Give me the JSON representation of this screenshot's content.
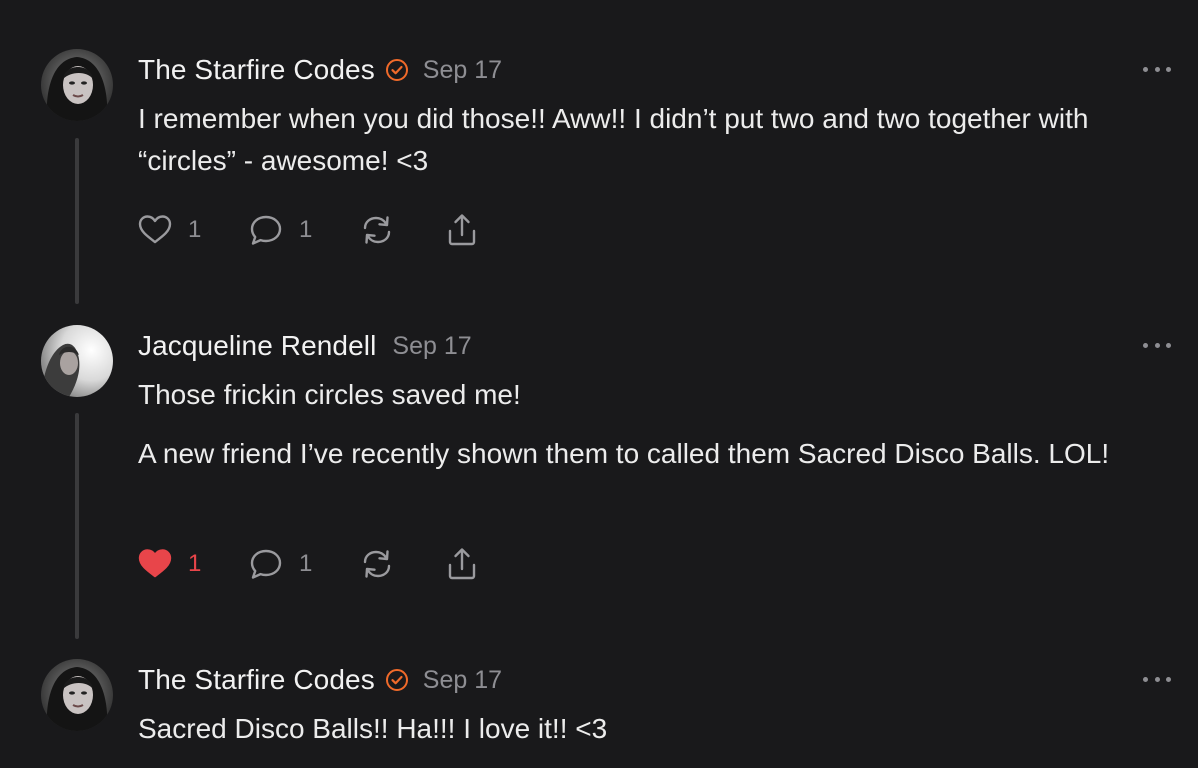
{
  "comments": [
    {
      "author": "The Starfire Codes",
      "verified": true,
      "date": "Sep 17",
      "paragraphs": [
        "I remember when you did those!! Aww!! I didn’t put two and two together with “circles” - awesome! <3"
      ],
      "likes": "1",
      "liked": false,
      "replies": "1"
    },
    {
      "author": "Jacqueline Rendell",
      "verified": false,
      "date": "Sep 17",
      "paragraphs": [
        "Those frickin circles saved me!",
        "A new friend I’ve recently shown them to called them Sacred Disco Balls. LOL!"
      ],
      "likes": "1",
      "liked": true,
      "replies": "1"
    },
    {
      "author": "The Starfire Codes",
      "verified": true,
      "date": "Sep 17",
      "paragraphs": [
        "Sacred Disco Balls!! Ha!!! I love it!! <3"
      ]
    }
  ],
  "colors": {
    "background": "#19191b",
    "verified_badge": "#f06a2a",
    "liked_heart": "#e8454a",
    "muted": "#8e8e93",
    "thread_line": "#3a3a3c"
  },
  "icons": {
    "verified": "check-circle-icon",
    "like": "heart-icon",
    "reply": "speech-bubble-icon",
    "restack": "restack-icon",
    "share": "share-icon",
    "more": "ellipsis-icon"
  }
}
